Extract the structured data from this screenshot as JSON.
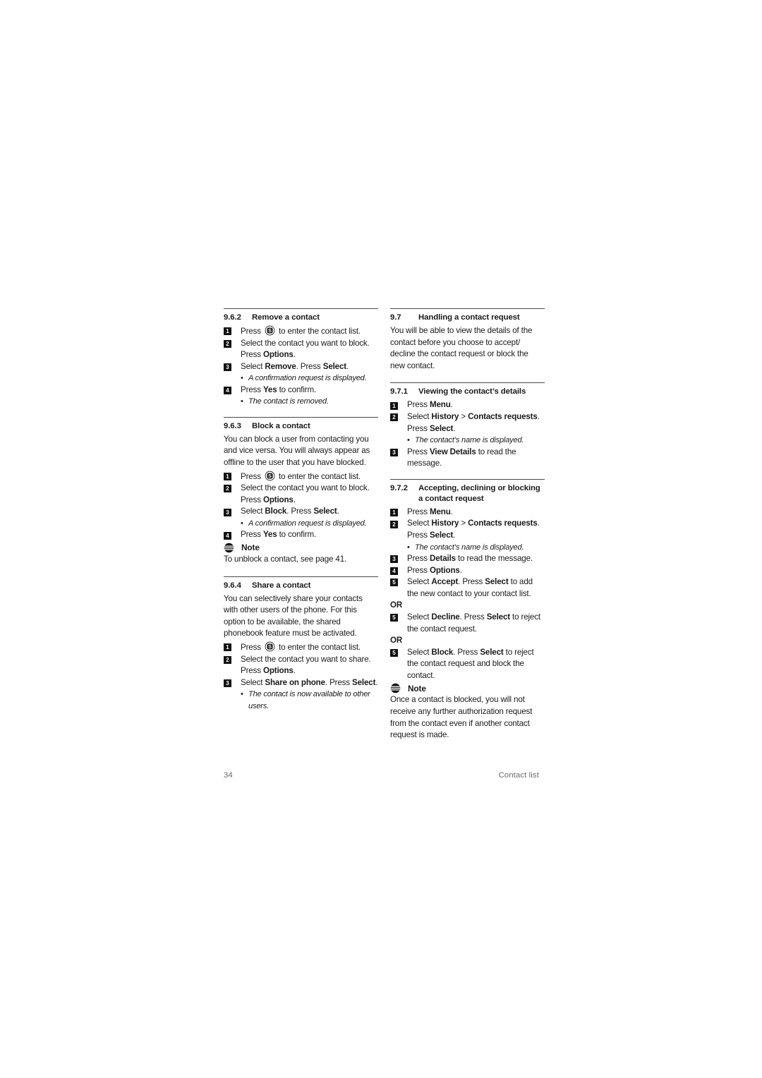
{
  "document": {
    "page_number": "34",
    "footer_section": "Contact list"
  },
  "icons": {
    "phonebook_key": "phonebook-key-icon",
    "note": "note-icon"
  },
  "left_column": {
    "sections": [
      {
        "id": "9.6.2",
        "number": "9.6.2",
        "title": "Remove a contact",
        "steps": [
          {
            "n": "1",
            "html": "Press <span class=\"kb\"></span> to enter the contact list."
          },
          {
            "n": "2",
            "html": "Select the contact you want to block. Press <b>Options</b>."
          },
          {
            "n": "3",
            "html": "Select <b>Remove</b>. Press <b>Select</b>."
          },
          {
            "bullet": "A confirmation request is displayed."
          },
          {
            "n": "4",
            "html": "Press <b>Yes</b> to confirm."
          },
          {
            "bullet": "The contact is removed."
          }
        ]
      },
      {
        "id": "9.6.3",
        "number": "9.6.3",
        "title": "Block a contact",
        "intro": "You can block a user from contacting you and vice versa. You will always appear as offline to the user that you have blocked.",
        "steps": [
          {
            "n": "1",
            "html": "Press <span class=\"kb\"></span> to enter the contact list."
          },
          {
            "n": "2",
            "html": "Select the contact you want to block. Press <b>Options</b>."
          },
          {
            "n": "3",
            "html": "Select <b>Block</b>. Press <b>Select</b>."
          },
          {
            "bullet": "A confirmation request is displayed."
          },
          {
            "n": "4",
            "html": "Press <b>Yes</b> to confirm."
          }
        ],
        "note": {
          "title": "Note",
          "body": "To unblock a contact, see page 41."
        }
      },
      {
        "id": "9.6.4",
        "number": "9.6.4",
        "title": "Share a contact",
        "intro": "You can selectively share your contacts with other users of the phone. For this option to be available, the shared phonebook feature must be activated.",
        "steps": [
          {
            "n": "1",
            "html": "Press <span class=\"kb\"></span> to enter the contact list."
          },
          {
            "n": "2",
            "html": "Select the contact you want to share. Press <b>Options</b>."
          },
          {
            "n": "3",
            "html": "Select <b>Share on phone</b>. Press <b>Select</b>."
          },
          {
            "bullet": "The contact is now available to other users."
          }
        ]
      }
    ]
  },
  "right_column": {
    "sections": [
      {
        "id": "9.7",
        "number": "9.7",
        "title": "Handling a contact request",
        "intro": "You will be able to view the details of the contact before you choose to accept/ decline the contact request or block the new contact."
      },
      {
        "id": "9.7.1",
        "number": "9.7.1",
        "title": "Viewing the contact’s details",
        "steps": [
          {
            "n": "1",
            "html": "Press <b>Menu</b>."
          },
          {
            "n": "2",
            "html": "Select <b>History</b> &gt; <b>Contacts requests</b>. Press <b>Select</b>."
          },
          {
            "bullet": "The contact’s name is displayed."
          },
          {
            "n": "3",
            "html": "Press <b>View Details</b> to read the message."
          }
        ]
      },
      {
        "id": "9.7.2",
        "number": "9.7.2",
        "title": "Accepting, declining or blocking a contact request",
        "steps": [
          {
            "n": "1",
            "html": "Press <b>Menu</b>."
          },
          {
            "n": "2",
            "html": "Select <b>History</b> &gt; <b>Contacts requests</b>. Press <b>Select</b>."
          },
          {
            "bullet": "The contact’s name is displayed."
          },
          {
            "n": "3",
            "html": "Press <b>Details</b> to read the message."
          },
          {
            "n": "4",
            "html": "Press <b>Options</b>."
          },
          {
            "n": "5",
            "html": "Select <b>Accept</b>. Press <b>Select</b> to add the new contact to your contact list."
          },
          {
            "or": "OR"
          },
          {
            "n": "5",
            "html": "Select <b>Decline</b>. Press <b>Select</b> to reject the contact request."
          },
          {
            "or": "OR"
          },
          {
            "n": "5",
            "html": "Select <b>Block</b>. Press <b>Select</b> to reject the contact request and block the contact."
          }
        ],
        "note": {
          "title": "Note",
          "body": "Once a contact is blocked, you will not receive any further authorization request from the contact even if another contact request is made."
        }
      }
    ]
  },
  "colors": {
    "text": "#1a1a1a",
    "rule": "#4a4a4a",
    "footer": "#6b6b6b",
    "step_marker_bg": "#111111"
  }
}
